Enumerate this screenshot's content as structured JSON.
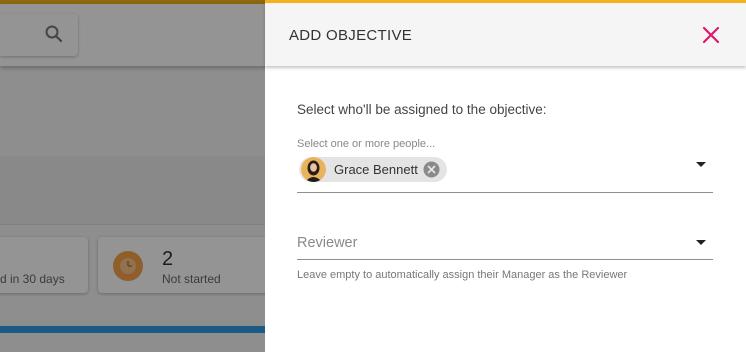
{
  "dialog": {
    "title": "ADD OBJECTIVE",
    "close_icon": "close-icon",
    "prompt": "Select who'll be assigned to the objective:",
    "assignees": {
      "label": "Select one or more people...",
      "selected": [
        {
          "name": "Grace Bennett",
          "avatar_icon": "avatar-photo",
          "remove_icon": "remove-chip-icon"
        }
      ]
    },
    "reviewer": {
      "placeholder": "Reviewer",
      "value": "",
      "helper": "Leave empty to automatically assign their Manager as the Reviewer"
    }
  },
  "background": {
    "search_icon": "search-icon",
    "cards": [
      {
        "label": "d in 30 days"
      },
      {
        "count": "2",
        "label": "Not started",
        "icon": "clock-icon"
      }
    ]
  },
  "colors": {
    "accent": "#f5b31b",
    "close": "#e0176c",
    "progress": "#2d9ce3",
    "clock": "#f6a24a"
  }
}
